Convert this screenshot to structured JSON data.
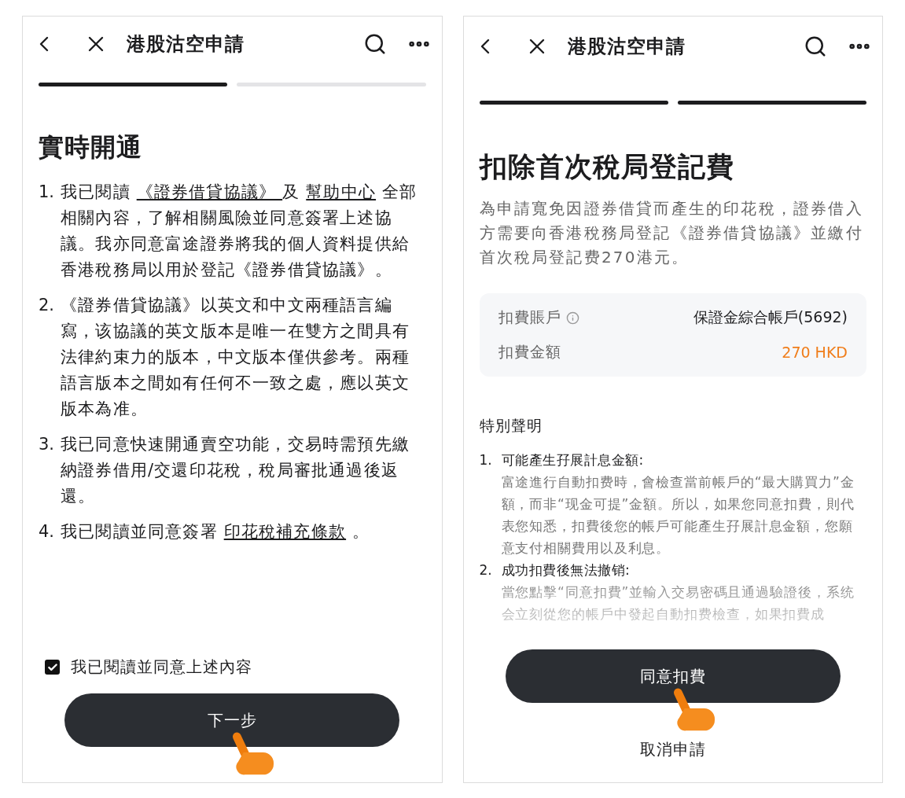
{
  "terms_screen": {
    "header": {
      "title": "港股沽空申請"
    },
    "progress": [
      {
        "done": true
      },
      {
        "done": false
      }
    ],
    "heading": "實時開通",
    "terms": [
      {
        "number": "1.",
        "segments": [
          {
            "kind": "text",
            "text": "我已閱讀 "
          },
          {
            "kind": "link",
            "text": "《證券借貸協議》 "
          },
          {
            "kind": "text",
            "text": " 及 "
          },
          {
            "kind": "link",
            "text": "幫助中心"
          },
          {
            "kind": "text",
            "text": " 全部相關內容，了解相關風險並同意簽署上述協議。我亦同意富途證券將我的個人資料提供給香港稅務局以用於登記《證券借貸協議》。"
          }
        ]
      },
      {
        "number": "2.",
        "segments": [
          {
            "kind": "text",
            "text": "《證券借貸協議》以英文和中文兩種語言編寫，该協議的英文版本是唯一在雙方之間具有法律約束力的版本，中文版本僅供參考。兩種語言版本之間如有任何不一致之處，應以英文版本為准。"
          }
        ]
      },
      {
        "number": "3.",
        "segments": [
          {
            "kind": "text",
            "text": "我已同意快速開通賣空功能，交易時需預先繳納證券借用/交還印花稅，稅局審批通過後返還。"
          }
        ]
      },
      {
        "number": "4.",
        "segments": [
          {
            "kind": "text",
            "text": "我已閱讀並同意簽署 "
          },
          {
            "kind": "link",
            "text": "印花稅補充條款"
          },
          {
            "kind": "text",
            "text": " 。"
          }
        ]
      }
    ],
    "agreement": {
      "label": "我已閱讀並同意上述內容",
      "checked": true
    },
    "primary_button": "下一步"
  },
  "fee_screen": {
    "header": {
      "title": "港股沽空申請"
    },
    "progress": [
      {
        "done": true
      },
      {
        "done": true
      }
    ],
    "heading": "扣除首次稅局登記費",
    "description": "為申請寬免因證券借貸而產生的印花稅，證券借入方需要向香港稅務局登記《證券借貸協議》並繳付首次稅局登記费270港元。",
    "fee_rows": [
      {
        "label": "扣費賬戶",
        "info": true,
        "value": "保證金綜合帳戶(5692)",
        "highlight": false
      },
      {
        "label": "扣費金額",
        "info": false,
        "value": "270 HKD",
        "highlight": true
      }
    ],
    "notice_title": "特別聲明",
    "notices": [
      {
        "number": "1.",
        "title": "可能產生孖展計息金額:",
        "body": "富途進行自動扣费時，會檢查當前帳戶的“最大購買力”金額，而非“现金可提”金額。所以，如果您同意扣費，則代表您知悉，扣費後您的帳戶可能產生孖展計息金額，您願意支付相關費用以及利息。"
      },
      {
        "number": "2.",
        "title": "成功扣費後無法撤销:",
        "body": "當您點擊“同意扣費”並輸入交易密碼且通過驗證後，系统会立刻從您的帳戶中發起自動扣费檢查，如果扣費成"
      }
    ],
    "primary_button": "同意扣費",
    "secondary_button": "取消申請"
  }
}
